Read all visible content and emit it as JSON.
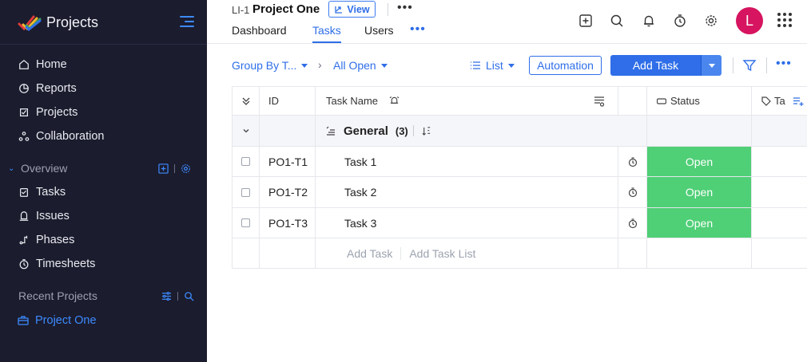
{
  "sidebar": {
    "brand": "Projects",
    "nav": [
      {
        "label": "Home",
        "icon": "home-icon"
      },
      {
        "label": "Reports",
        "icon": "reports-icon"
      },
      {
        "label": "Projects",
        "icon": "projects-icon"
      },
      {
        "label": "Collaboration",
        "icon": "collaboration-icon"
      }
    ],
    "overview_label": "Overview",
    "overview_items": [
      {
        "label": "Tasks",
        "icon": "tasks-icon"
      },
      {
        "label": "Issues",
        "icon": "issues-icon"
      },
      {
        "label": "Phases",
        "icon": "phases-icon"
      },
      {
        "label": "Timesheets",
        "icon": "timesheets-icon"
      }
    ],
    "recent_label": "Recent Projects",
    "recent_project": "Project One"
  },
  "header": {
    "project_id": "LI-1",
    "project_title": "Project One",
    "view_label": "View",
    "tabs": [
      {
        "label": "Dashboard"
      },
      {
        "label": "Tasks",
        "active": true
      },
      {
        "label": "Users"
      }
    ],
    "avatar_initial": "L"
  },
  "toolbar": {
    "group_by": "Group By T...",
    "filter_view": "All Open",
    "list_label": "List",
    "automation_label": "Automation",
    "add_task_label": "Add Task"
  },
  "table": {
    "columns": {
      "id": "ID",
      "task_name": "Task Name",
      "status": "Status",
      "next": "Ta"
    },
    "group": {
      "name": "General",
      "count": "(3)"
    },
    "rows": [
      {
        "id": "PO1-T1",
        "name": "Task 1",
        "status": "Open"
      },
      {
        "id": "PO1-T2",
        "name": "Task 2",
        "status": "Open"
      },
      {
        "id": "PO1-T3",
        "name": "Task 3",
        "status": "Open"
      }
    ],
    "add_task": "Add Task",
    "add_task_list": "Add Task List"
  },
  "colors": {
    "sidebar_bg": "#1b1c2e",
    "accent": "#2f6ee8",
    "status_open": "#4fcf76",
    "avatar": "#d6145f"
  }
}
